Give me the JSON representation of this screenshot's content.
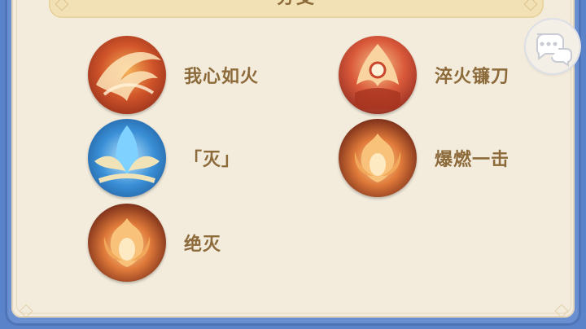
{
  "header": {
    "title": "分支"
  },
  "skills": [
    {
      "label": "我心如火",
      "icon": "fire-swirl-icon"
    },
    {
      "label": "淬火镰刀",
      "icon": "flame-blade-icon"
    },
    {
      "label": "「灭」",
      "icon": "ice-wing-icon"
    },
    {
      "label": "爆燃一击",
      "icon": "flame-burst-icon"
    },
    {
      "label": "绝灭",
      "icon": "flame-burst-icon"
    }
  ],
  "chat": {
    "icon": "chat-bubbles-icon"
  },
  "colors": {
    "frame": "#6a8fd0",
    "panel": "#f3ecdd",
    "header_bar": "#f1e1b5",
    "text": "#8c6a3a"
  }
}
